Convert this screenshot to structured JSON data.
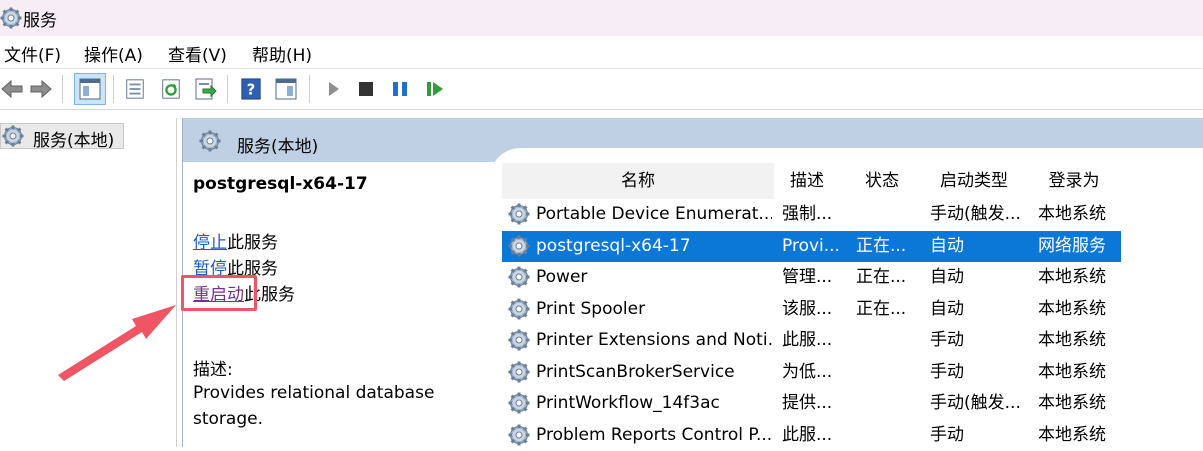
{
  "window": {
    "title": "服务"
  },
  "menu": [
    "文件(F)",
    "操作(A)",
    "查看(V)",
    "帮助(H)"
  ],
  "tree": {
    "item_label": "服务(本地)"
  },
  "panel": {
    "header_label": "服务(本地)",
    "service_name": "postgresql-x64-17",
    "actions": [
      {
        "link": "停止",
        "suffix": "此服务"
      },
      {
        "link": "暂停",
        "suffix": "此服务"
      },
      {
        "link": "重启动",
        "suffix": "此服务"
      }
    ],
    "description_label": "描述:",
    "description_text": "Provides relational database storage."
  },
  "table": {
    "columns": [
      "名称",
      "描述",
      "状态",
      "启动类型",
      "登录为"
    ],
    "rows": [
      {
        "name": "Portable Device Enumerat...",
        "desc": "强制...",
        "status": "",
        "startup": "手动(触发...",
        "logon": "本地系统",
        "selected": false
      },
      {
        "name": "postgresql-x64-17",
        "desc": "Provi...",
        "status": "正在...",
        "startup": "自动",
        "logon": "网络服务",
        "selected": true
      },
      {
        "name": "Power",
        "desc": "管理...",
        "status": "正在...",
        "startup": "自动",
        "logon": "本地系统",
        "selected": false
      },
      {
        "name": "Print Spooler",
        "desc": "该服...",
        "status": "正在...",
        "startup": "自动",
        "logon": "本地系统",
        "selected": false
      },
      {
        "name": "Printer Extensions and Noti...",
        "desc": "此服...",
        "status": "",
        "startup": "手动",
        "logon": "本地系统",
        "selected": false
      },
      {
        "name": "PrintScanBrokerService",
        "desc": "为低...",
        "status": "",
        "startup": "手动",
        "logon": "本地系统",
        "selected": false
      },
      {
        "name": "PrintWorkflow_14f3ac",
        "desc": "提供...",
        "status": "",
        "startup": "手动(触发...",
        "logon": "本地系统",
        "selected": false
      },
      {
        "name": "Problem Reports Control P...",
        "desc": "此服...",
        "status": "",
        "startup": "手动",
        "logon": "本地系统",
        "selected": false
      }
    ]
  },
  "colors": {
    "selection": "#0b78d7",
    "header": "#bfd0e4",
    "highlight_box": "#f05563",
    "arrow": "#f05563",
    "link": "#1f5bc4"
  },
  "icons": [
    "gear-icon",
    "back-icon",
    "forward-icon",
    "console-tree-icon",
    "properties-icon",
    "refresh-icon",
    "export-icon",
    "help-icon",
    "show-hide-icon",
    "play-icon",
    "stop-icon",
    "pause-icon",
    "resume-icon"
  ]
}
